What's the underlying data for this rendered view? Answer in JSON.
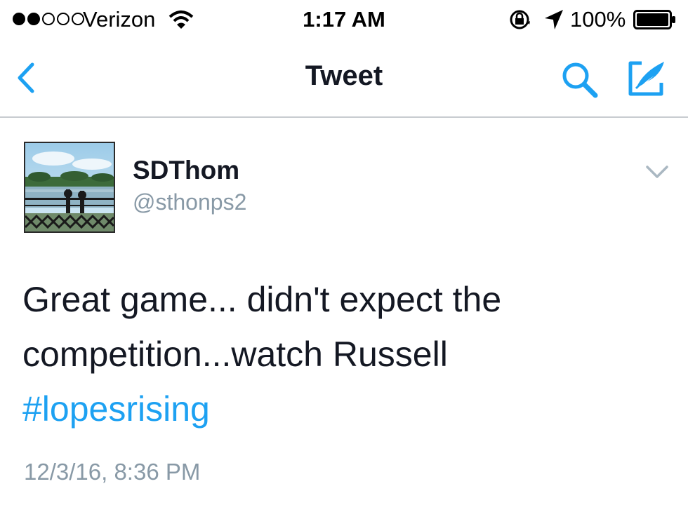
{
  "status_bar": {
    "signal_bars_filled": 2,
    "signal_bars_total": 5,
    "carrier": "Verizon",
    "time": "1:17 AM",
    "battery_percent": "100%",
    "icons": [
      "wifi-icon",
      "orientation-lock-icon",
      "location-arrow-icon",
      "battery-icon"
    ]
  },
  "nav": {
    "title": "Tweet",
    "accent_color": "#1da1f2",
    "icons": [
      "back-chevron-icon",
      "search-icon",
      "compose-tweet-icon"
    ]
  },
  "tweet": {
    "display_name": "SDThom",
    "handle": "@sthonps2",
    "text_line_1": "Great game... didn't expect the",
    "text_line_2": "competition...watch Russell",
    "hashtag": "#lopesrising",
    "timestamp": "12/3/16, 8:36 PM",
    "hashtag_color": "#1da1f2",
    "avatar_icon": "lake-railing-photo"
  }
}
